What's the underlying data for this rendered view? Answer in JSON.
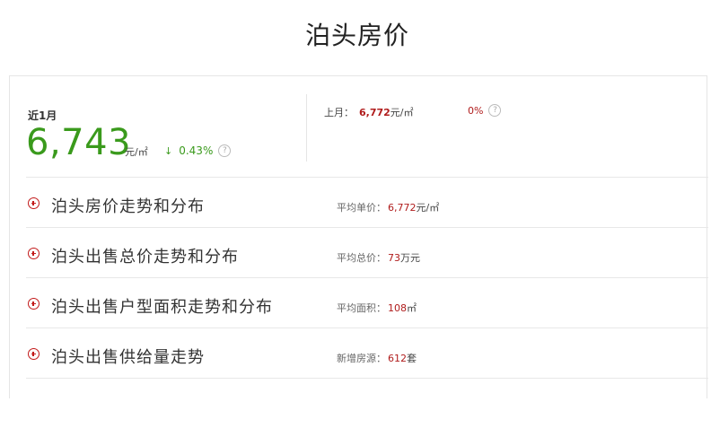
{
  "page": {
    "title": "泊头房价"
  },
  "summary": {
    "recent_label": "近1月",
    "recent_value": "6,743",
    "recent_unit": "元/㎡",
    "change_arrow": "↓",
    "change_value": "0.43%",
    "last_month_label": "上月：",
    "last_month_value": "6,772",
    "last_month_unit": "元/㎡",
    "mom_value": "0%",
    "help_glyph": "?"
  },
  "rows": [
    {
      "title": "泊头房价走势和分布",
      "stat_label": "平均单价：",
      "stat_value": "6,772",
      "stat_unit": "元/㎡"
    },
    {
      "title": "泊头出售总价走势和分布",
      "stat_label": "平均总价：",
      "stat_value": "73",
      "stat_unit": "万元"
    },
    {
      "title": "泊头出售户型面积走势和分布",
      "stat_label": "平均面积：",
      "stat_value": "108",
      "stat_unit": "㎡"
    },
    {
      "title": "泊头出售供给量走势",
      "stat_label": "新增房源：",
      "stat_value": "612",
      "stat_unit": "套"
    }
  ],
  "colors": {
    "up_down_green": "#3a9a1c",
    "accent_red": "#b01c1c"
  },
  "icons": {
    "expand": "plus-circle-icon",
    "help": "question-circle-icon",
    "trend": "down-arrow-icon"
  }
}
